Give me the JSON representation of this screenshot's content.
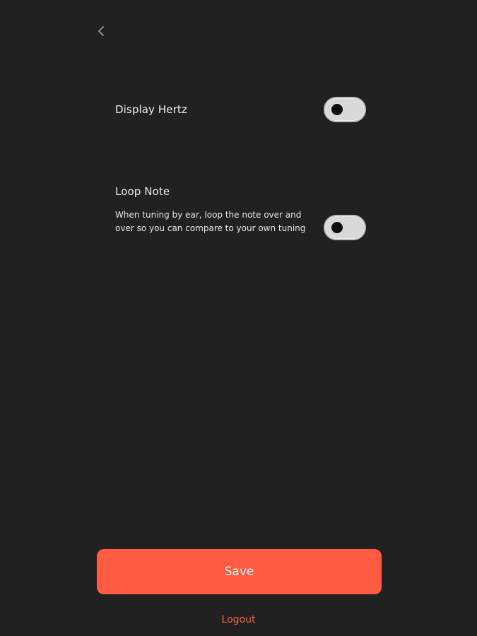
{
  "header": {
    "back_icon": "chevron-left-icon"
  },
  "settings": [
    {
      "title": "Display Hertz",
      "toggle_state": "off"
    },
    {
      "title": "Loop Note",
      "description": "When tuning by ear, loop the note over and over so you can compare to your own tuning",
      "toggle_state": "off"
    }
  ],
  "actions": {
    "save_label": "Save",
    "logout_label": "Logout"
  },
  "colors": {
    "background": "#212121",
    "accent": "#ff5b43",
    "toggle_track": "#d9d9d9",
    "toggle_knob": "#0d0d0d"
  }
}
